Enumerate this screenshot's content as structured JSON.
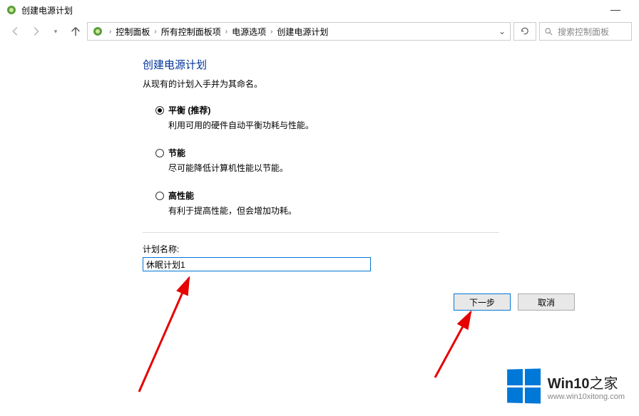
{
  "window": {
    "title": "创建电源计划"
  },
  "breadcrumb": {
    "items": [
      "控制面板",
      "所有控制面板项",
      "电源选项",
      "创建电源计划"
    ]
  },
  "search": {
    "placeholder": "搜索控制面板"
  },
  "page": {
    "heading": "创建电源计划",
    "subheading": "从现有的计划入手并为其命名。"
  },
  "options": [
    {
      "label": "平衡 (推荐)",
      "desc": "利用可用的硬件自动平衡功耗与性能。",
      "checked": true
    },
    {
      "label": "节能",
      "desc": "尽可能降低计算机性能以节能。",
      "checked": false
    },
    {
      "label": "高性能",
      "desc": "有利于提高性能，但会增加功耗。",
      "checked": false
    }
  ],
  "planName": {
    "label": "计划名称:",
    "value": "休眠计划1"
  },
  "buttons": {
    "next": "下一步",
    "cancel": "取消"
  },
  "watermark": {
    "brand_main": "Win10",
    "brand_suffix": "之家",
    "url": "www.win10xitong.com"
  }
}
